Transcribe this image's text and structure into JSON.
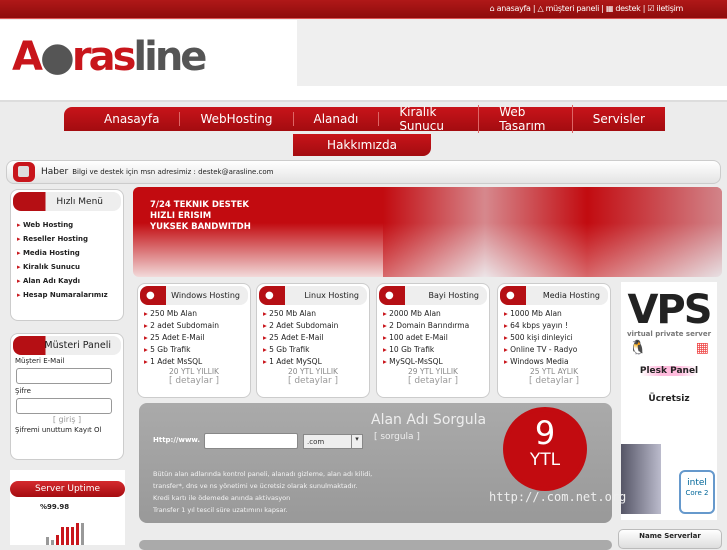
{
  "top_links": [
    "anasayfa",
    "müşteri paneli",
    "destek",
    "iletişim"
  ],
  "logo": "arasline",
  "nav": [
    "Anasayfa",
    "WebHosting",
    "Alanadı",
    "Kiralık Sunucu",
    "Web Tasarım",
    "Servisler"
  ],
  "nav2": "Hakkımızda",
  "haber": {
    "label": "Haber",
    "text": "Bilgi ve destek için msn adresimiz : destek@arasline.com"
  },
  "quick_menu": {
    "title": "Hızlı Menü",
    "items": [
      "Web Hosting",
      "Reseller Hosting",
      "Media Hosting",
      "Kiralık Sunucu",
      "Alan Adı Kaydı",
      "Hesap Numaralarımız"
    ]
  },
  "customer_panel": {
    "title": "Müsteri Paneli",
    "email_label": "Müşteri E-Mail",
    "password_label": "Şifre",
    "login": "[   giriş   ]",
    "forgot": "Şifremi unuttum",
    "register": "Kayıt Ol"
  },
  "uptime": {
    "title": "Server Uptime",
    "value": "%99.98"
  },
  "banner": [
    "7/24 TEKNIK DESTEK",
    "HIZLI ERISIM",
    "YUKSEK BANDWITDH"
  ],
  "cards": [
    {
      "title": "Windows Hosting",
      "items": [
        "250 Mb Alan",
        "2 adet Subdomain",
        "25 Adet E-Mail",
        "5 Gb Trafik",
        "1 Adet MsSQL"
      ],
      "price": "20 YTL YILLIK",
      "details": "[ detaylar ]"
    },
    {
      "title": "Linux Hosting",
      "items": [
        "250 Mb Alan",
        "2 Adet Subdomain",
        "25 Adet E-Mail",
        "5 Gb Trafik",
        "1 Adet MySQL"
      ],
      "price": "20 YTL YILLIK",
      "details": "[ detaylar ]"
    },
    {
      "title": "Bayi Hosting",
      "items": [
        "2000 Mb Alan",
        "2 Domain Barındırma",
        "100 adet E-Mail",
        "10 Gb Trafik",
        "MySQL-MsSQL"
      ],
      "price": "29 YTL YILLIK",
      "details": "[ detaylar ]"
    },
    {
      "title": "Media Hosting",
      "items": [
        "1000 Mb Alan",
        "64 kbps yayın !",
        "500 kişi dinleyici",
        "Online TV - Radyo",
        "Windows Media"
      ],
      "price": "25 YTL AYLIK",
      "details": "[ detaylar ]"
    }
  ],
  "vps": {
    "title": "VPS",
    "subtitle": "virtual private server",
    "plesk": "Plesk Panel",
    "free": "Ücretsiz",
    "intel": "intel",
    "core": "Core 2"
  },
  "domain": {
    "title": "Alan Adı Sorgula",
    "http_label": "Http://www.",
    "tld": ".com",
    "search": "[ sorgula ]",
    "price_num": "9",
    "price_unit": "YTL",
    "exts": "http://.com.net.org",
    "desc": [
      "Bütün alan adlarında kontrol paneli, alanadı gizleme, alan adı kilidi,",
      "transfer*, dns ve ns yönetimi ve ücretsiz olarak sunulmaktadır.",
      "Kredi kartı ile ödemede anında aktivasyon",
      "Transfer 1 yıl tescil süre uzatımını kapsar."
    ]
  },
  "name_servers": "Name Serverlar"
}
